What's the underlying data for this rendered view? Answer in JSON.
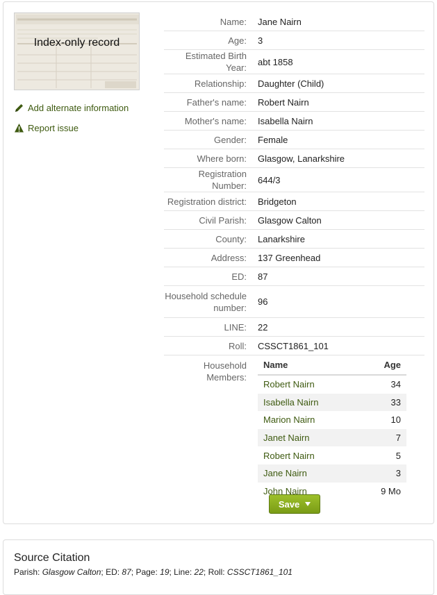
{
  "thumbnail": {
    "label": "Index-only record"
  },
  "actions": {
    "add_alternate": "Add alternate information",
    "report_issue": "Report issue"
  },
  "fields": [
    {
      "label": "Name:",
      "value": "Jane Nairn"
    },
    {
      "label": "Age:",
      "value": "3"
    },
    {
      "label": "Estimated Birth Year:",
      "value": "abt 1858"
    },
    {
      "label": "Relationship:",
      "value": "Daughter (Child)"
    },
    {
      "label": "Father's name:",
      "value": "Robert Nairn"
    },
    {
      "label": "Mother's name:",
      "value": "Isabella Nairn"
    },
    {
      "label": "Gender:",
      "value": "Female"
    },
    {
      "label": "Where born:",
      "value": "Glasgow, Lanarkshire"
    },
    {
      "label": "Registration Number:",
      "value": "644/3"
    },
    {
      "label": "Registration district:",
      "value": "Bridgeton"
    },
    {
      "label": "Civil Parish:",
      "value": "Glasgow Calton"
    },
    {
      "label": "County:",
      "value": "Lanarkshire"
    },
    {
      "label": "Address:",
      "value": "137 Greenhead"
    },
    {
      "label": "ED:",
      "value": "87"
    },
    {
      "label": "Household schedule number:",
      "value": "96"
    },
    {
      "label": "LINE:",
      "value": "22"
    },
    {
      "label": "Roll:",
      "value": "CSSCT1861_101"
    }
  ],
  "household": {
    "label": "Household Members:",
    "col_name": "Name",
    "col_age": "Age",
    "members": [
      {
        "name": "Robert Nairn",
        "age": "34"
      },
      {
        "name": "Isabella Nairn",
        "age": "33"
      },
      {
        "name": "Marion Nairn",
        "age": "10"
      },
      {
        "name": "Janet Nairn",
        "age": "7"
      },
      {
        "name": "Robert Nairn",
        "age": "5"
      },
      {
        "name": "Jane Nairn",
        "age": "3"
      },
      {
        "name": "John Nairn",
        "age": "9 Mo"
      }
    ]
  },
  "save_label": "Save",
  "citation": {
    "title": "Source Citation",
    "parish_label": "Parish: ",
    "parish": "Glasgow Calton",
    "ed_label": "; ED: ",
    "ed": "87",
    "page_label": "; Page: ",
    "page": "19",
    "line_label": "; Line: ",
    "line": "22",
    "roll_label": "; Roll: ",
    "roll": "CSSCT1861_101"
  },
  "colors": {
    "link": "#3e5a10",
    "button": "#8cae20"
  }
}
